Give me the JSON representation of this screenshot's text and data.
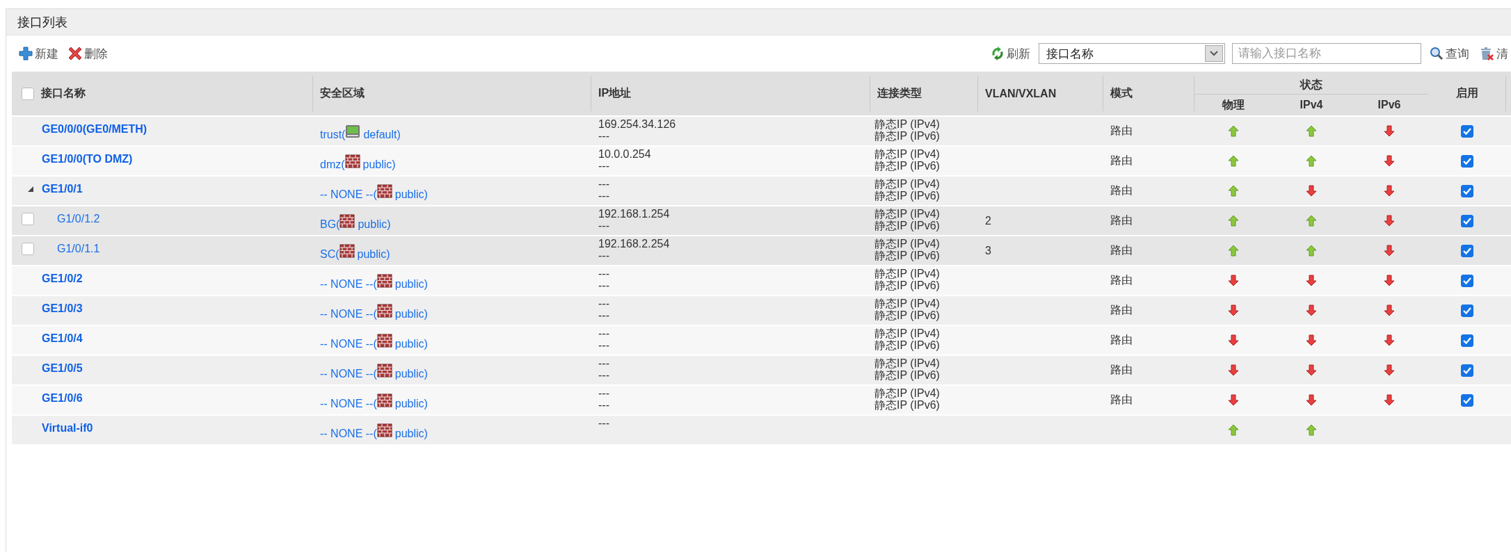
{
  "panel": {
    "title": "接口列表"
  },
  "toolbar": {
    "left": [
      {
        "kind": "add",
        "label": "新建"
      },
      {
        "kind": "delete",
        "label": "删除"
      }
    ],
    "refresh": "刷新",
    "filter_select": "接口名称",
    "search": {
      "placeholder": "请输入接口名称"
    },
    "query": "查询",
    "clear": "清"
  },
  "table": {
    "select_all": false,
    "columns": [
      "接口名称",
      "安全区域",
      "IP地址",
      "连接类型",
      "VLAN/VXLAN",
      "模式",
      "状态",
      "启用"
    ],
    "status_columns": [
      "物理",
      "IPv4",
      "IPv6"
    ],
    "rows": [
      {
        "name": "GE0/0/0(GE0/METH)",
        "zone": "trust(",
        "vsys": {
          "kind": "device",
          "label": "default)"
        },
        "ip": [
          "169.254.34.126",
          "---"
        ],
        "conn": [
          "静态IP (IPv4)",
          "静态IP (IPv6)"
        ],
        "mode": "路由",
        "status_up": [
          true,
          true,
          false
        ],
        "enabled": true
      },
      {
        "name": "GE1/0/0(TO DMZ)",
        "zone": "dmz(",
        "vsys": {
          "kind": "wall",
          "label": "public)"
        },
        "ip": [
          "10.0.0.254",
          "---"
        ],
        "conn": [
          "静态IP (IPv4)",
          "静态IP (IPv6)"
        ],
        "mode": "路由",
        "status_up": [
          true,
          true,
          false
        ],
        "enabled": true
      },
      {
        "name": "GE1/0/1",
        "expanded": true,
        "zone": "-- NONE --(",
        "vsys": {
          "kind": "wall",
          "label": "public)"
        },
        "ip": [
          "---",
          "---"
        ],
        "conn": [
          "静态IP (IPv4)",
          "静态IP (IPv6)"
        ],
        "mode": "路由",
        "status_up": [
          true,
          false,
          false
        ],
        "enabled": true,
        "children": [
          {
            "name": "G1/0/1.2",
            "selected": false,
            "zone": "BG(",
            "vsys": {
              "kind": "wall",
              "label": "public)"
            },
            "ip": [
              "192.168.1.254",
              "---"
            ],
            "conn": [
              "静态IP (IPv4)",
              "静态IP (IPv6)"
            ],
            "vlan": "2",
            "mode": "路由",
            "status_up": [
              true,
              true,
              false
            ],
            "enabled": true
          },
          {
            "name": "G1/0/1.1",
            "selected": false,
            "zone": "SC(",
            "vsys": {
              "kind": "wall",
              "label": "public)"
            },
            "ip": [
              "192.168.2.254",
              "---"
            ],
            "conn": [
              "静态IP (IPv4)",
              "静态IP (IPv6)"
            ],
            "vlan": "3",
            "mode": "路由",
            "status_up": [
              true,
              true,
              false
            ],
            "enabled": true
          }
        ]
      },
      {
        "name": "GE1/0/2",
        "zone": "-- NONE --(",
        "vsys": {
          "kind": "wall",
          "label": "public)"
        },
        "ip": [
          "---",
          "---"
        ],
        "conn": [
          "静态IP (IPv4)",
          "静态IP (IPv6)"
        ],
        "mode": "路由",
        "status_up": [
          false,
          false,
          false
        ],
        "enabled": true
      },
      {
        "name": "GE1/0/3",
        "zone": "-- NONE --(",
        "vsys": {
          "kind": "wall",
          "label": "public)"
        },
        "ip": [
          "---",
          "---"
        ],
        "conn": [
          "静态IP (IPv4)",
          "静态IP (IPv6)"
        ],
        "mode": "路由",
        "status_up": [
          false,
          false,
          false
        ],
        "enabled": true
      },
      {
        "name": "GE1/0/4",
        "zone": "-- NONE --(",
        "vsys": {
          "kind": "wall",
          "label": "public)"
        },
        "ip": [
          "---",
          "---"
        ],
        "conn": [
          "静态IP (IPv4)",
          "静态IP (IPv6)"
        ],
        "mode": "路由",
        "status_up": [
          false,
          false,
          false
        ],
        "enabled": true
      },
      {
        "name": "GE1/0/5",
        "zone": "-- NONE --(",
        "vsys": {
          "kind": "wall",
          "label": "public)"
        },
        "ip": [
          "---",
          "---"
        ],
        "conn": [
          "静态IP (IPv4)",
          "静态IP (IPv6)"
        ],
        "mode": "路由",
        "status_up": [
          false,
          false,
          false
        ],
        "enabled": true
      },
      {
        "name": "GE1/0/6",
        "zone": "-- NONE --(",
        "vsys": {
          "kind": "wall",
          "label": "public)"
        },
        "ip": [
          "---",
          "---"
        ],
        "conn": [
          "静态IP (IPv4)",
          "静态IP (IPv6)"
        ],
        "mode": "路由",
        "status_up": [
          false,
          false,
          false
        ],
        "enabled": true
      },
      {
        "name": "Virtual-if0",
        "zone": "-- NONE --(",
        "vsys": {
          "kind": "wall",
          "label": "public)"
        },
        "ip": [
          "---"
        ],
        "status_up": [
          true,
          true
        ]
      }
    ]
  }
}
